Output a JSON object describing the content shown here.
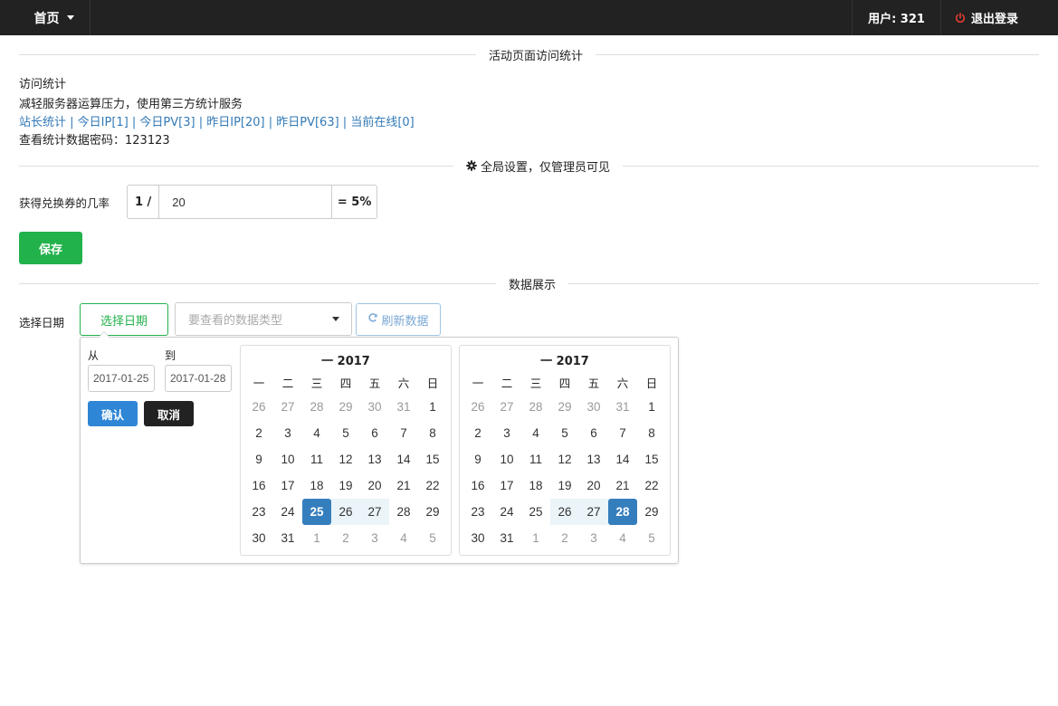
{
  "navbar": {
    "home_label": "首页",
    "user_label": "用户: 321",
    "logout_label": "退出登录"
  },
  "sections": {
    "visit_stats_title": "活动页面访问统计",
    "global_settings_title": "全局设置，仅管理员可见",
    "data_display_title": "数据展示"
  },
  "visit": {
    "heading": "访问统计",
    "description": "减轻服务器运算压力，使用第三方统计服务",
    "links": [
      "站长统计",
      "今日IP[1]",
      "今日PV[3]",
      "昨日IP[20]",
      "昨日PV[63]",
      "当前在线[0]"
    ],
    "separator": " | ",
    "password_text": "查看统计数据密码：123123"
  },
  "settings": {
    "probability_label": "获得兑换券的几率",
    "prefix": "1 /",
    "value": "20",
    "suffix": "= 5%",
    "save_label": "保存"
  },
  "filters": {
    "date_label": "选择日期",
    "date_button": "选择日期",
    "type_placeholder": "要查看的数据类型",
    "refresh_label": "刷新数据"
  },
  "datepicker": {
    "from_label": "从",
    "to_label": "到",
    "from_value": "2017-01-25",
    "to_value": "2017-01-28",
    "confirm_label": "确认",
    "cancel_label": "取消",
    "weekdays": [
      "一",
      "二",
      "三",
      "四",
      "五",
      "六",
      "日"
    ],
    "calendars": [
      {
        "title": "一 2017",
        "weeks": [
          [
            26,
            27,
            28,
            29,
            30,
            31,
            1
          ],
          [
            2,
            3,
            4,
            5,
            6,
            7,
            8
          ],
          [
            9,
            10,
            11,
            12,
            13,
            14,
            15
          ],
          [
            16,
            17,
            18,
            19,
            20,
            21,
            22
          ],
          [
            23,
            24,
            25,
            26,
            27,
            28,
            29
          ],
          [
            30,
            31,
            1,
            2,
            3,
            4,
            5
          ]
        ]
      },
      {
        "title": "一 2017",
        "weeks": [
          [
            26,
            27,
            28,
            29,
            30,
            31,
            1
          ],
          [
            2,
            3,
            4,
            5,
            6,
            7,
            8
          ],
          [
            9,
            10,
            11,
            12,
            13,
            14,
            15
          ],
          [
            16,
            17,
            18,
            19,
            20,
            21,
            22
          ],
          [
            23,
            24,
            25,
            26,
            27,
            28,
            29
          ],
          [
            30,
            31,
            1,
            2,
            3,
            4,
            5
          ]
        ]
      }
    ],
    "range_start": 25,
    "range_end": 28,
    "range_week_index": 4
  },
  "colors": {
    "navbar_bg": "#222222",
    "accent_green": "#22b24c",
    "link_blue": "#337ab7",
    "selected_blue": "#357ebd",
    "power_red": "#e03c31"
  }
}
